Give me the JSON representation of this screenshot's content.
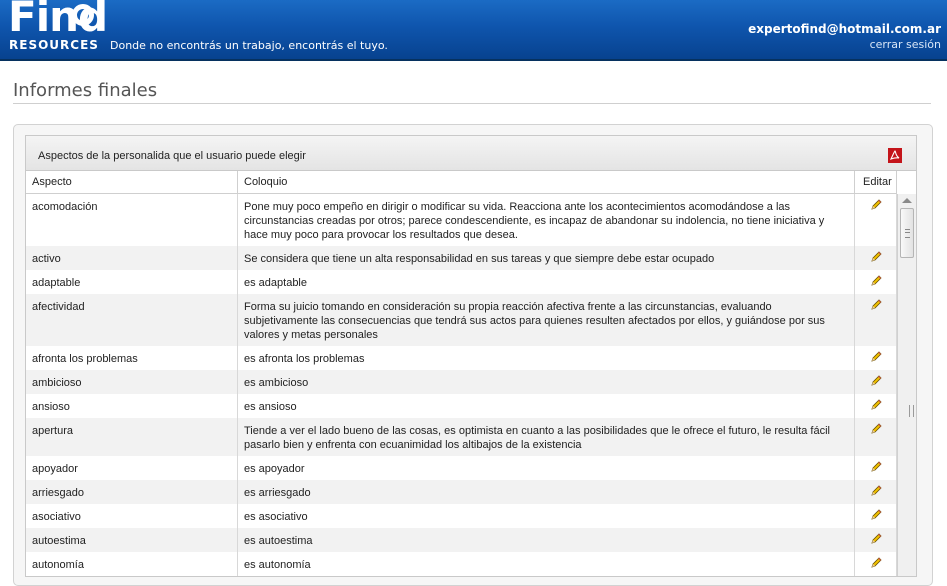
{
  "header": {
    "logo_find": "Find",
    "logo_resources": "RESOURCES",
    "tagline": "Donde no encontrás un trabajo, encontrás el tuyo.",
    "user_email": "expertofind@hotmail.com.ar",
    "logout_label": "cerrar sesión"
  },
  "page": {
    "title": "Informes finales"
  },
  "grid": {
    "caption": "Aspectos de la personalida que el usuario puede elegir",
    "export_icon": "pdf-icon",
    "columns": {
      "aspecto": "Aspecto",
      "coloquio": "Coloquio",
      "editar": "Editar"
    },
    "edit_icon": "pencil-icon",
    "rows": [
      {
        "aspecto": "acomodación",
        "coloquio": "Pone muy poco empeño en dirigir o modificar su vida. Reacciona ante los acontecimientos acomodándose a las circunstancias creadas por otros; parece condescendiente, es incapaz de abandonar su indolencia, no tiene iniciativa y hace muy poco para provocar los resultados que desea."
      },
      {
        "aspecto": "activo",
        "coloquio": "Se considera que tiene un alta responsabilidad en sus tareas y que siempre debe estar ocupado"
      },
      {
        "aspecto": "adaptable",
        "coloquio": "es adaptable"
      },
      {
        "aspecto": "afectividad",
        "coloquio": "Forma su juicio tomando en consideración su propia reacción afectiva frente a las circunstancias, evaluando subjetivamente las consecuencias que tendrá sus actos para quienes resulten afectados por ellos, y guiándose por sus valores y metas personales"
      },
      {
        "aspecto": "afronta los problemas",
        "coloquio": "es afronta los problemas"
      },
      {
        "aspecto": "ambicioso",
        "coloquio": "es ambicioso"
      },
      {
        "aspecto": "ansioso",
        "coloquio": "es ansioso"
      },
      {
        "aspecto": "apertura",
        "coloquio": "Tiende a ver el lado bueno de las cosas, es optimista en cuanto a las posibilidades que le ofrece el futuro, le resulta fácil pasarlo bien y enfrenta con ecuanimidad los altibajos de la existencia"
      },
      {
        "aspecto": "apoyador",
        "coloquio": "es apoyador"
      },
      {
        "aspecto": "arriesgado",
        "coloquio": "es arriesgado"
      },
      {
        "aspecto": "asociativo",
        "coloquio": "es asociativo"
      },
      {
        "aspecto": "autoestima",
        "coloquio": "es autoestima"
      },
      {
        "aspecto": "autonomía",
        "coloquio": "es autonomía"
      }
    ]
  },
  "colors": {
    "header_blue": "#0f55ad",
    "alt_row": "#f2f2f2",
    "pdf_red": "#c4141a",
    "pencil_yellow": "#f2c200"
  }
}
